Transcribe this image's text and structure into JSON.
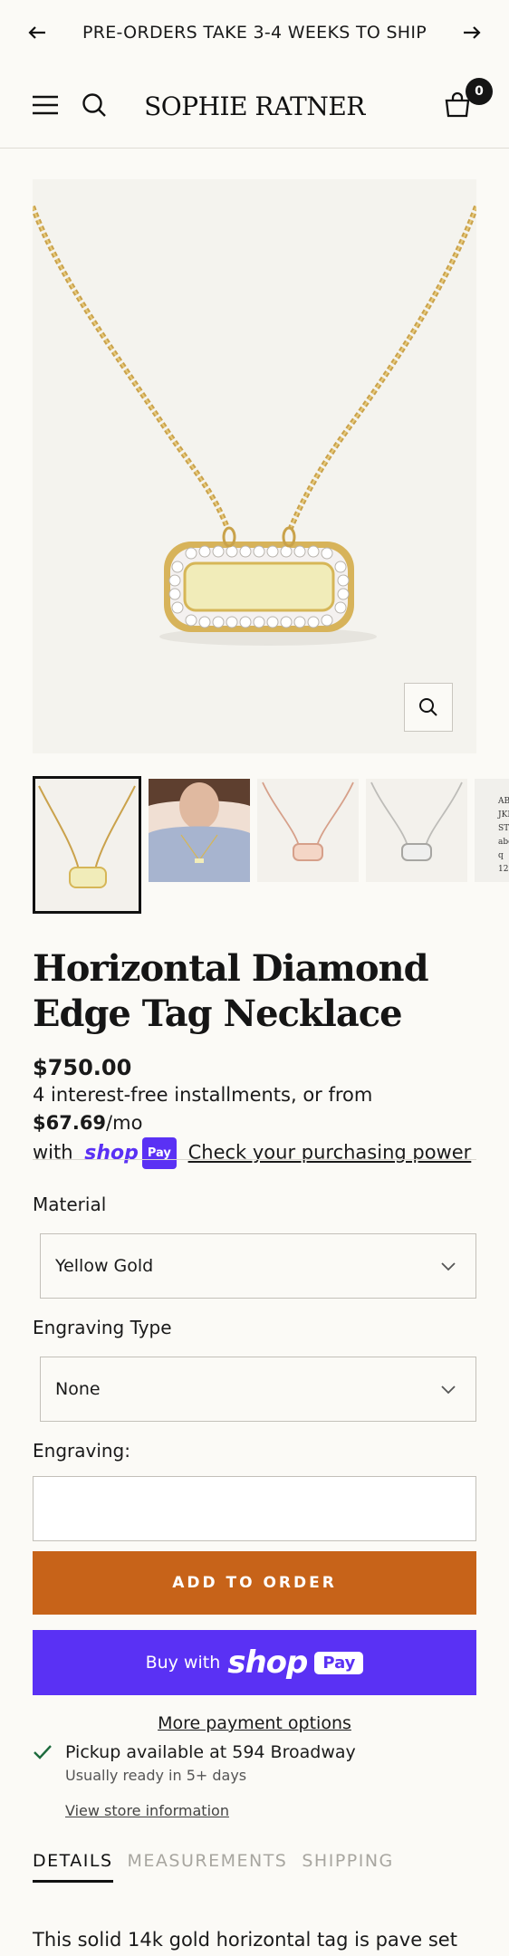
{
  "announcement": {
    "text": "PRE-ORDERS TAKE 3-4 WEEKS TO SHIP"
  },
  "header": {
    "logo": "SOPHIE RATNER",
    "cart_count": "0"
  },
  "thumbnails": [
    {
      "kind": "necklace-gold"
    },
    {
      "kind": "model-photo"
    },
    {
      "kind": "necklace-rose"
    },
    {
      "kind": "necklace-white"
    },
    {
      "kind": "engraving-samples",
      "lines": [
        "AB",
        "JKL",
        "ST",
        "abcd",
        "q",
        "12"
      ]
    }
  ],
  "product": {
    "title": "Horizontal Diamond Edge Tag Necklace",
    "price": "$750.00",
    "installments_pre": "4 interest-free installments, or from ",
    "installments_amount": "$67.69",
    "installments_post": "/mo",
    "with_label": "with",
    "shop_text": "shop",
    "pay_text": "Pay",
    "purchasing_power_link": "Check your purchasing power"
  },
  "options": {
    "material_label": "Material",
    "material_value": "Yellow Gold",
    "engraving_type_label": "Engraving Type",
    "engraving_type_value": "None",
    "engraving_label": "Engraving:",
    "engraving_value": ""
  },
  "actions": {
    "add_to_order": "ADD TO ORDER",
    "buy_with": "Buy with",
    "buy_shop": "shop",
    "buy_pay": "Pay",
    "more_payment_options": "More payment options"
  },
  "pickup": {
    "title": "Pickup available at 594 Broadway",
    "subtitle": "Usually ready in 5+ days",
    "store_link": "View store information"
  },
  "tabs": [
    {
      "label": "DETAILS",
      "active": true
    },
    {
      "label": "MEASUREMENTS",
      "active": false
    },
    {
      "label": "SHIPPING",
      "active": false
    }
  ],
  "details_text": "This solid 14k gold horizontal tag is pave set",
  "colors": {
    "accent": "#c76319",
    "shop_pay": "#5a31f4",
    "gold": "#d4a94a",
    "background": "#fbfaf6"
  }
}
